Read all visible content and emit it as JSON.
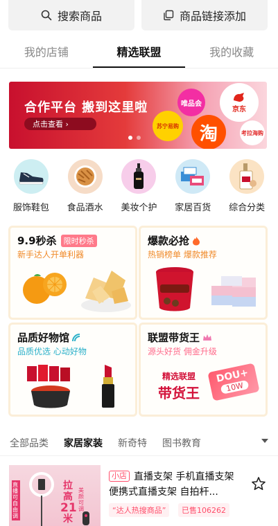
{
  "top_buttons": {
    "search_label": "搜索商品",
    "link_label": "商品链接添加"
  },
  "tabs": [
    {
      "label": "我的店铺",
      "active": false
    },
    {
      "label": "精选联盟",
      "active": true
    },
    {
      "label": "我的收藏",
      "active": false
    }
  ],
  "banner": {
    "title": "合作平台 搬到这里啦",
    "button": "点击查看 ›",
    "logos": {
      "vipshop": "唯品会",
      "jd": "京东",
      "suning": "苏宁易购",
      "taobao": "淘",
      "aliexpress": "考拉海购"
    },
    "dots_total": 2,
    "dot_active": 1
  },
  "categories": [
    {
      "label": "服饰鞋包",
      "icon": "sneaker-icon",
      "bg": "#cdeef2"
    },
    {
      "label": "食品酒水",
      "icon": "snack-bowl-icon",
      "bg": "#f6dcc7"
    },
    {
      "label": "美妆个护",
      "icon": "serum-bottle-icon",
      "bg": "#f7cdea"
    },
    {
      "label": "家居百货",
      "icon": "tissue-box-icon",
      "bg": "#cfe9f6"
    },
    {
      "label": "综合分类",
      "icon": "gift-bag-icon",
      "bg": "#fbe3c4"
    }
  ],
  "cards": {
    "c1": {
      "title": "9.9秒杀",
      "tag": "限时秒杀",
      "sub": "新手达人开单利器",
      "sub_color": "#f08a2a"
    },
    "c2": {
      "title": "爆款必抢",
      "sub": "热销榜单 爆款推荐",
      "sub_color": "#f08a2a",
      "icon": "fire-icon"
    },
    "c3": {
      "title": "品质好物馆",
      "sub": "品质优选 心动好物",
      "sub_color": "#2bb0c9",
      "icon": "signal-icon"
    },
    "c4": {
      "title": "联盟带货王",
      "sub": "源头好货 佣金升级",
      "sub_color": "#ff6b8b",
      "icon": "crown-icon",
      "stamp_line1": "精选联盟",
      "stamp_line2": "带货王",
      "coupon": "DOU+",
      "coupon_amount": "10W"
    }
  },
  "subtabs": [
    {
      "label": "全部品类",
      "active": false
    },
    {
      "label": "家居家装",
      "active": true
    },
    {
      "label": "新奇特",
      "active": false
    },
    {
      "label": "图书教育",
      "active": false
    }
  ],
  "product": {
    "shop_tag": "小店",
    "title": "直播支架 手机直播支架 便携式直播支架 自拍杆...",
    "badge1": "“达人热搜商品”",
    "badge2": "已售106262",
    "image_text1": "拉",
    "image_text2": "高",
    "image_text3": "21",
    "image_text4": "米",
    "image_side": "美颜可调",
    "image_left": "直播可自由调"
  },
  "colors": {
    "accent": "#ff4d6a",
    "tab_active": "#111111",
    "card_border": "#fbeed8"
  }
}
